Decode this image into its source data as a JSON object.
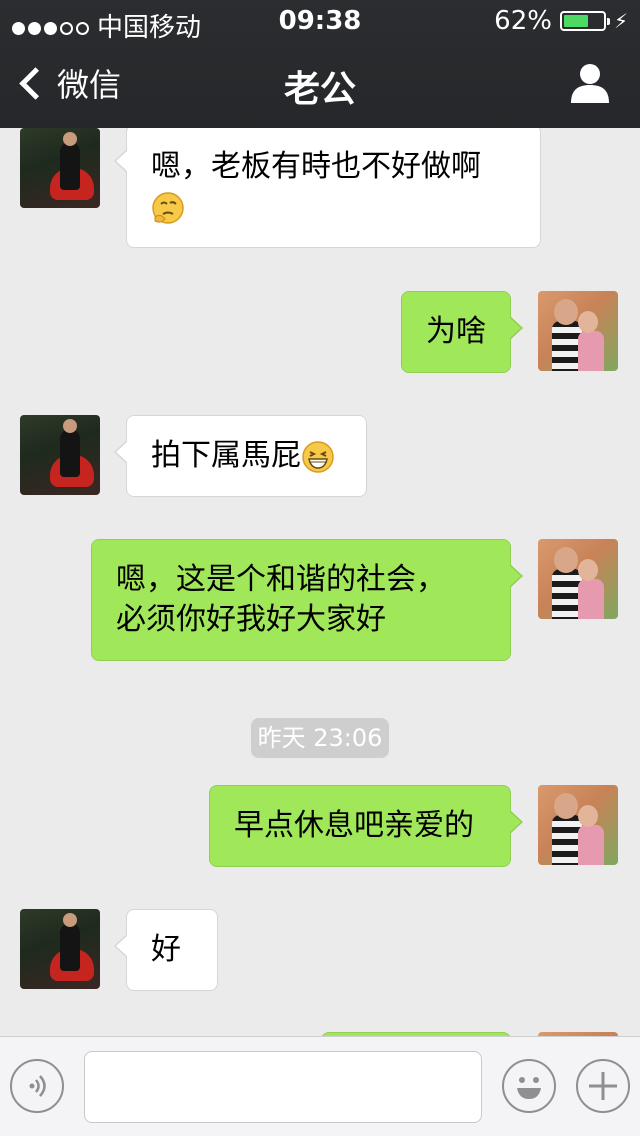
{
  "status_bar": {
    "carrier": "中国移动",
    "time": "09:38",
    "battery": "62%",
    "battery_level": 0.62
  },
  "nav": {
    "back_label": "微信",
    "title": "老公"
  },
  "messages": [
    {
      "from": "husband",
      "text": "嗯，老板有時也不好做啊",
      "emoji": "thinking-emoji"
    },
    {
      "from": "me",
      "text": "为啥"
    },
    {
      "from": "husband",
      "text": "拍下属馬屁",
      "emoji": "grin-emoji"
    },
    {
      "from": "me",
      "lines": [
        "嗯，这是个和谐的社会，",
        "必须你好我好大家好"
      ]
    },
    {
      "from": "me",
      "text": "早点休息吧亲爱的"
    },
    {
      "from": "husband",
      "text": "好"
    }
  ],
  "timestamp": "昨天 23:06",
  "input_bar": {
    "placeholder": "",
    "value": ""
  },
  "colors": {
    "nav_bg": "#2b2d30",
    "chat_bg": "#ebebeb",
    "outgoing_bubble": "#a0e75a",
    "incoming_bubble": "#ffffff",
    "battery_fill": "#4cd964"
  }
}
